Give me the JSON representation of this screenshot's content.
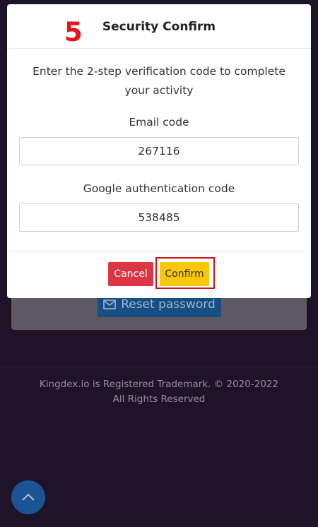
{
  "modal": {
    "step_number": "5",
    "title": "Security Confirm",
    "instruction": "Enter the 2-step verification code to complete your activity",
    "email_label": "Email code",
    "email_value": "267116",
    "google_label": "Google authentication code",
    "google_value": "538485",
    "cancel_label": "Cancel",
    "confirm_label": "Confirm"
  },
  "background": {
    "reset_button_label": "Reset password",
    "footer_line1": "Kingdex.io is Registered Trademark. © 2020-2022",
    "footer_line2": "All Rights Reserved"
  },
  "icons": {
    "reset": "envelope-icon",
    "scroll_top": "chevron-up-icon"
  },
  "colors": {
    "step_number": "#e8141c",
    "cancel_button": "#dc3545",
    "confirm_button": "#f9c70a",
    "highlight": "#d0121b",
    "page_background": "#1e1328",
    "scroll_top_button": "#1b5494"
  }
}
